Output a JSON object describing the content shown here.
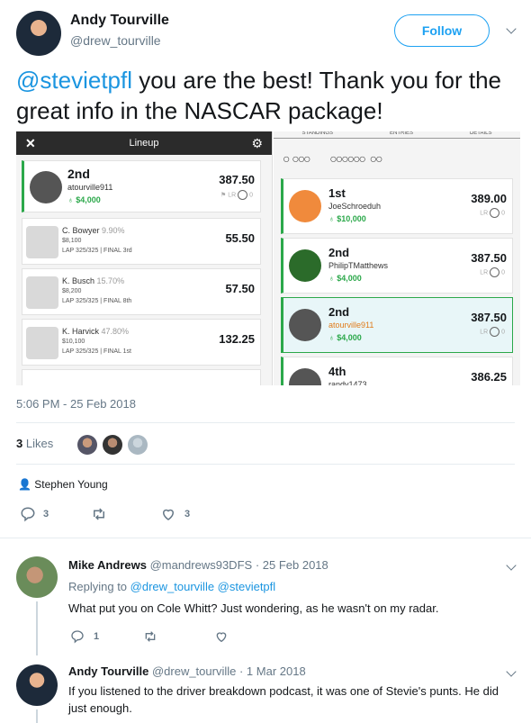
{
  "author": {
    "name": "Andy Tourville",
    "handle": "@drew_tourville",
    "follow_label": "Follow"
  },
  "tweet": {
    "mention": "@stevietpfl",
    "text": " you are the best!  Thank you for the great info in the NASCAR package!"
  },
  "lineup": {
    "title": "Lineup",
    "top": {
      "rank": "2nd",
      "user": "atourville911",
      "prize": "$4,000",
      "score": "387.50",
      "lr": "LR",
      "lr_count": "0"
    },
    "drivers": [
      {
        "name": "C. Bowyer",
        "pct": "9.90%",
        "salary": "$8,100",
        "lap": "LAP 325/325 | FINAL 3rd",
        "score": "55.50"
      },
      {
        "name": "K. Busch",
        "pct": "15.70%",
        "salary": "$8,200",
        "lap": "LAP 325/325 | FINAL 8th",
        "score": "57.50"
      },
      {
        "name": "K. Harvick",
        "pct": "47.80%",
        "salary": "$10,100",
        "lap": "LAP 325/325 | FINAL 1st",
        "score": "132.25"
      }
    ]
  },
  "standings": {
    "tabs": [
      "STANDINGS",
      "ENTRIES",
      "DETAILS"
    ],
    "rows": [
      {
        "rank": "1st",
        "user": "JoeSchroeduh",
        "prize": "$10,000",
        "score": "389.00",
        "lr": "LR",
        "lr_count": "0"
      },
      {
        "rank": "2nd",
        "user": "PhilipTMatthews",
        "prize": "$4,000",
        "score": "387.50",
        "lr": "LR",
        "lr_count": "0"
      },
      {
        "rank": "2nd",
        "user": "atourville911",
        "prize": "$4,000",
        "score": "387.50",
        "lr": "LR",
        "lr_count": "0"
      },
      {
        "rank": "4th",
        "user": "randy1473",
        "prize": "",
        "score": "386.25",
        "lr": "",
        "lr_count": ""
      }
    ]
  },
  "meta": {
    "time": "5:06 PM - 25 Feb 2018",
    "likes_count": "3",
    "likes_label": "Likes",
    "liker": "Stephen Young",
    "reply_count": "3",
    "like_count": "3"
  },
  "replies": [
    {
      "name": "Mike Andrews",
      "handle": "@mandrews93DFS",
      "date": "· 25 Feb 2018",
      "replying_prefix": "Replying to ",
      "replying_to": "@drew_tourville @stevietpfl",
      "text": "What put you on Cole Whitt? Just wondering, as he wasn't on my radar.",
      "reply_count": "1"
    },
    {
      "name": "Andy Tourville",
      "handle": "@drew_tourville",
      "date": "· 1 Mar 2018",
      "text": "If you listened to the driver breakdown podcast, it was one of Stevie's punts. He did just enough."
    }
  ]
}
